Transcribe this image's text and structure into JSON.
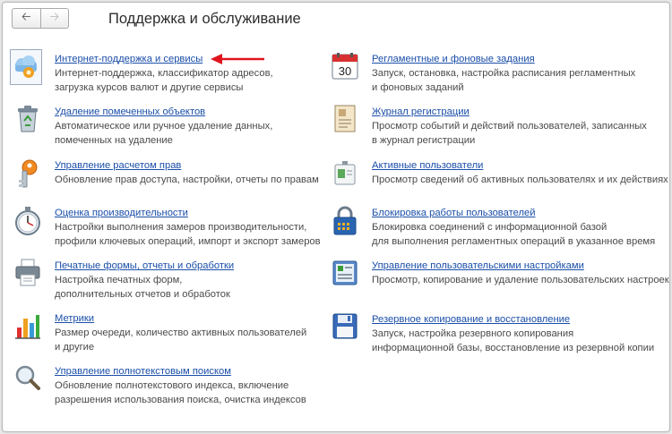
{
  "header": {
    "title": "Поддержка и обслуживание",
    "back_icon": "arrow-left-icon",
    "forward_icon": "arrow-right-icon"
  },
  "left_items": [
    {
      "key": "internet",
      "icon": "cloud-gear-icon",
      "label": "Интернет-поддержка и сервисы",
      "lines": [
        "Интернет-поддержка, классификатор адресов,",
        "загрузка курсов валют и другие сервисы"
      ]
    },
    {
      "key": "delete",
      "icon": "recycle-bin-icon",
      "label": "Удаление помеченных объектов",
      "lines": [
        "Автоматическое или ручное удаление данных,",
        "помеченных на удаление"
      ]
    },
    {
      "key": "rights",
      "icon": "key-icon",
      "label": "Управление расчетом прав",
      "lines": [
        "Обновление прав доступа, настройки, отчеты по правам"
      ]
    },
    {
      "key": "perf",
      "icon": "stopwatch-icon",
      "label": "Оценка производительности",
      "lines": [
        "Настройки выполнения замеров производительности,",
        "профили ключевых операций, импорт и экспорт замеров"
      ]
    },
    {
      "key": "print",
      "icon": "printer-icon",
      "label": "Печатные формы, отчеты и обработки",
      "lines": [
        "Настройка печатных форм,",
        "дополнительных отчетов и обработок"
      ]
    },
    {
      "key": "metrics",
      "icon": "bar-chart-icon",
      "label": "Метрики",
      "lines": [
        "Размер очереди, количество активных пользователей",
        "и другие"
      ]
    },
    {
      "key": "search",
      "icon": "magnifier-icon",
      "label": "Управление полнотекстовым поиском",
      "lines": [
        "Обновление полнотекстового индекса, включение",
        "разрешения использования поиска, очистка индексов"
      ]
    }
  ],
  "right_items": [
    {
      "key": "tasks",
      "icon": "calendar-icon",
      "calendar_day": "30",
      "label": "Регламентные и фоновые задания",
      "lines": [
        "Запуск, остановка, настройка расписания регламентных",
        "и фоновых заданий"
      ]
    },
    {
      "key": "log",
      "icon": "journal-icon",
      "label": "Журнал регистрации",
      "lines": [
        "Просмотр событий и действий пользователей, записанных",
        "в журнал регистрации"
      ]
    },
    {
      "key": "active",
      "icon": "badge-icon",
      "label": "Активные пользователи",
      "lines": [
        "Просмотр сведений об активных пользователях и их действиях"
      ]
    },
    {
      "key": "lock",
      "icon": "padlock-icon",
      "label": "Блокировка работы пользователей",
      "lines": [
        "Блокировка соединений с информационной базой",
        "для выполнения регламентных операций в указанное время"
      ]
    },
    {
      "key": "usersettings",
      "icon": "user-settings-icon",
      "label": "Управление пользовательскими настройками",
      "lines": [
        "Просмотр, копирование и удаление пользовательских настроек"
      ]
    },
    {
      "key": "backup",
      "icon": "floppy-disk-icon",
      "label": "Резервное копирование и восстановление",
      "lines": [
        "Запуск, настройка резервного копирования",
        "информационной базы, восстановление из резервной копии"
      ]
    }
  ],
  "annotation": {
    "arrow_color": "#e0141e",
    "arrow_icon": "red-arrow-icon"
  }
}
